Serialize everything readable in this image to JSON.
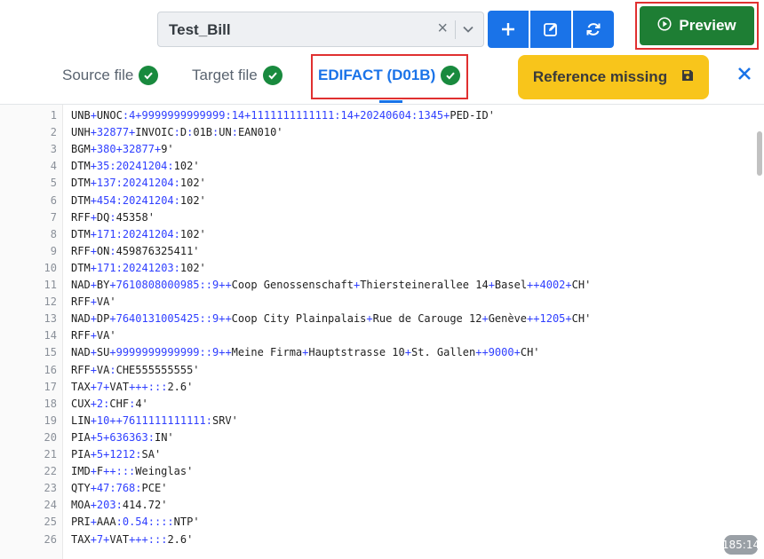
{
  "toolbar": {
    "selected_bill": "Test_Bill",
    "clear_symbol": "×",
    "preview_label": "Preview"
  },
  "tabs": [
    {
      "label": "Source file",
      "status": "complete"
    },
    {
      "label": "Target file",
      "status": "complete"
    },
    {
      "label": "EDIFACT (D01B)",
      "status": "complete",
      "active": true
    }
  ],
  "reference": {
    "label": "Reference missing"
  },
  "editor": {
    "cursor_position": "185:14",
    "lines": [
      "UNB+UNOC:4+9999999999999:14+1111111111111:14+20240604:1345+PED-ID'",
      "UNH+32877+INVOIC:D:01B:UN:EAN010'",
      "BGM+380+32877+9'",
      "DTM+35:20241204:102'",
      "DTM+137:20241204:102'",
      "DTM+454:20241204:102'",
      "RFF+DQ:45358'",
      "DTM+171:20241204:102'",
      "RFF+ON:459876325411'",
      "DTM+171:20241203:102'",
      "NAD+BY+7610808000985::9++Coop Genossenschaft+Thiersteinerallee 14+Basel++4002+CH'",
      "RFF+VA'",
      "NAD+DP+7640131005425::9++Coop City Plainpalais+Rue de Carouge 12+Genève++1205+CH'",
      "RFF+VA'",
      "NAD+SU+9999999999999::9++Meine Firma+Hauptstrasse 10+St. Gallen++9000+CH'",
      "RFF+VA:CHE555555555'",
      "TAX+7+VAT+++:::2.6'",
      "CUX+2:CHF:4'",
      "LIN+10++7611111111111:SRV'",
      "PIA+5+636363:IN'",
      "PIA+5+1212:SA'",
      "IMD+F++:::Weinglas'",
      "QTY+47:768:PCE'",
      "MOA+203:414.72'",
      "PRI+AAA:0.54::::NTP'",
      "TAX+7+VAT+++:::2.6'"
    ]
  },
  "colors": {
    "primary": "#1a73e8",
    "success": "#198a3e",
    "preview": "#1e7e34",
    "warning": "#f8c51b",
    "highlight_outline": "#e03030",
    "delimiter": "#2f3fff"
  }
}
